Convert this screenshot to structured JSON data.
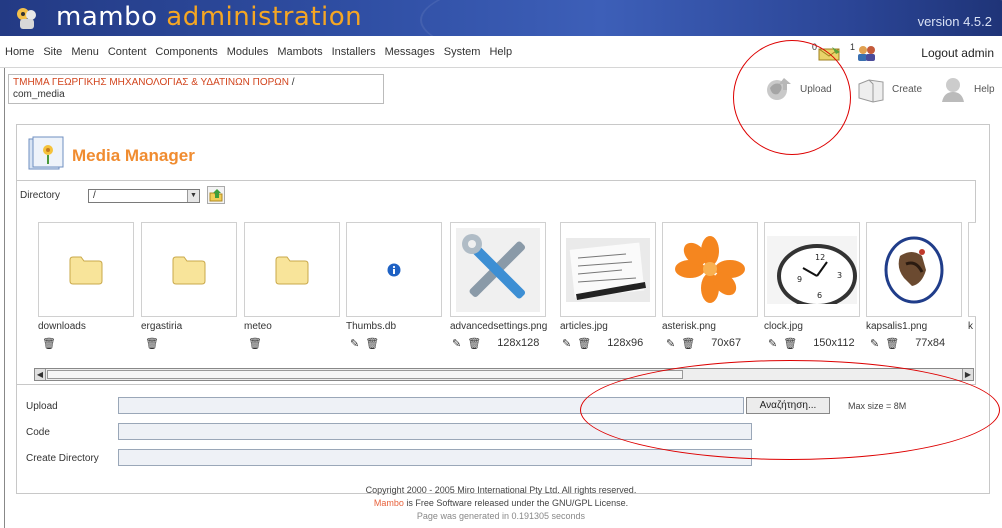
{
  "header": {
    "logo_text_main": "mambo",
    "logo_text_accent": "administration",
    "version": "version 4.5.2"
  },
  "menu": {
    "items": [
      "Home",
      "Site",
      "Menu",
      "Content",
      "Components",
      "Modules",
      "Mambots",
      "Installers",
      "Messages",
      "System",
      "Help"
    ],
    "messages_count": "0",
    "users_count": "1",
    "logout": "Logout admin"
  },
  "pathway": {
    "site_name": "ΤΜΗΜΑ ΓΕΩΡΓΙΚΗΣ ΜΗΧΑΝΟΛΟΓΙΑΣ & ΥΔΑΤΙΝΩΝ ΠΟΡΩΝ",
    "separator": " /",
    "component": "com_media"
  },
  "toolbar": {
    "upload": "Upload",
    "create": "Create",
    "help": "Help"
  },
  "media_manager": {
    "title": "Media Manager",
    "directory_label": "Directory",
    "directory_value": "/"
  },
  "files": [
    {
      "name": "downloads",
      "type": "folder",
      "dims": ""
    },
    {
      "name": "ergastiria",
      "type": "folder",
      "dims": ""
    },
    {
      "name": "meteo",
      "type": "folder",
      "dims": ""
    },
    {
      "name": "Thumbs.db",
      "type": "file",
      "dims": ""
    },
    {
      "name": "advancedsettings.png",
      "type": "image",
      "dims": "128x128"
    },
    {
      "name": "articles.jpg",
      "type": "image",
      "dims": "128x96"
    },
    {
      "name": "asterisk.png",
      "type": "image",
      "dims": "70x67"
    },
    {
      "name": "clock.jpg",
      "type": "image",
      "dims": "150x112"
    },
    {
      "name": "kapsalis1.png",
      "type": "image",
      "dims": "77x84"
    }
  ],
  "form": {
    "upload_label": "Upload",
    "code_label": "Code",
    "create_dir_label": "Create Directory",
    "browse_button": "Αναζήτηση...",
    "max_size": "Max size = 8M"
  },
  "footer": {
    "copyright": "Copyright 2000 - 2005 Miro International Pty Ltd. All rights reserved.",
    "mambo_word": "Mambo",
    "license_rest": " is Free Software released under the GNU/GPL License.",
    "generated": "Page was generated in 0.191305 seconds"
  },
  "colors": {
    "accent_orange": "#f08c30",
    "header_blue": "#2f4ea3",
    "annotation_red": "#dd0000"
  }
}
